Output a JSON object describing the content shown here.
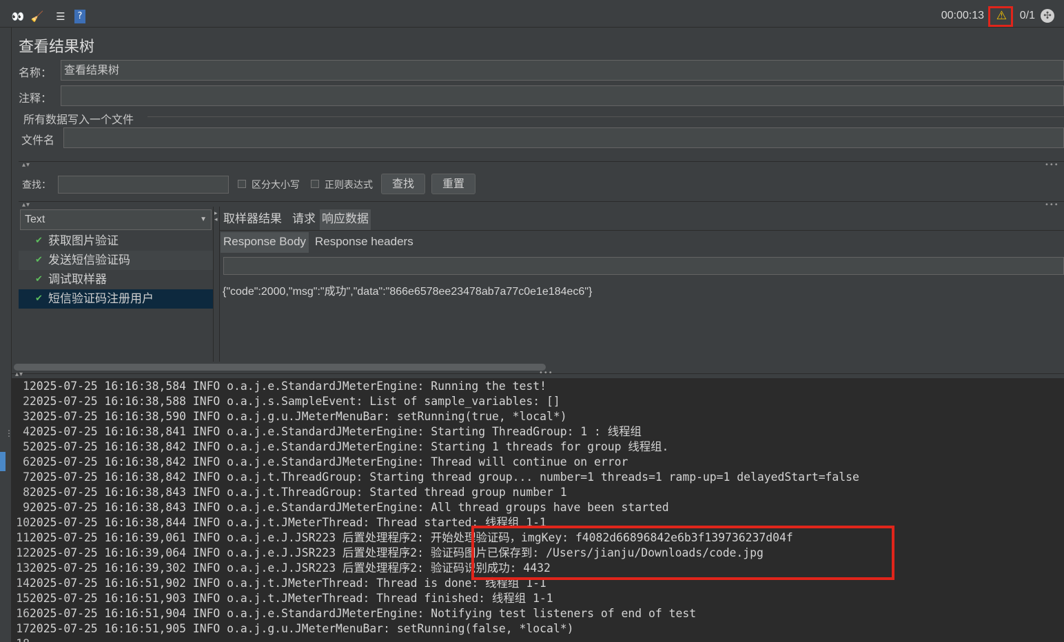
{
  "toolbar": {
    "timer": "00:00:13",
    "threads": "0/1",
    "icons": [
      "binoculars-icon",
      "broom-icon",
      "list-icon",
      "help-icon",
      "warning-icon",
      "globe-icon"
    ]
  },
  "panel": {
    "title": "查看结果树",
    "name_label": "名称：",
    "name_value": "查看结果树",
    "comment_label": "注释：",
    "comment_value": "",
    "file_section_label": "所有数据写入一个文件",
    "filename_label": "文件名",
    "filename_value": ""
  },
  "search": {
    "label": "查找：",
    "value": "",
    "case_label": "区分大小写",
    "regex_label": "正则表达式",
    "find_button": "查找",
    "reset_button": "重置"
  },
  "tree": {
    "renderer": "Text",
    "items": [
      {
        "label": "获取图片验证"
      },
      {
        "label": "发送短信验证码"
      },
      {
        "label": "调试取样器"
      },
      {
        "label": "短信验证码注册用户"
      }
    ]
  },
  "result": {
    "tabs": [
      "取样器结果",
      "请求",
      "响应数据"
    ],
    "subtabs": [
      "Response Body",
      "Response headers"
    ],
    "body": "{\"code\":2000,\"msg\":\"成功\",\"data\":\"866e6578ee23478ab7a77c0e1e184ec6\"}"
  },
  "log": {
    "lines": [
      {
        "n": "1",
        "text": "2025-07-25 16:16:38,584 INFO o.a.j.e.StandardJMeterEngine: Running the test!"
      },
      {
        "n": "2",
        "text": "2025-07-25 16:16:38,588 INFO o.a.j.s.SampleEvent: List of sample_variables: []"
      },
      {
        "n": "3",
        "text": "2025-07-25 16:16:38,590 INFO o.a.j.g.u.JMeterMenuBar: setRunning(true, *local*)"
      },
      {
        "n": "4",
        "text": "2025-07-25 16:16:38,841 INFO o.a.j.e.StandardJMeterEngine: Starting ThreadGroup: 1 : 线程组"
      },
      {
        "n": "5",
        "text": "2025-07-25 16:16:38,842 INFO o.a.j.e.StandardJMeterEngine: Starting 1 threads for group 线程组."
      },
      {
        "n": "6",
        "text": "2025-07-25 16:16:38,842 INFO o.a.j.e.StandardJMeterEngine: Thread will continue on error"
      },
      {
        "n": "7",
        "text": "2025-07-25 16:16:38,842 INFO o.a.j.t.ThreadGroup: Starting thread group... number=1 threads=1 ramp-up=1 delayedStart=false"
      },
      {
        "n": "8",
        "text": "2025-07-25 16:16:38,843 INFO o.a.j.t.ThreadGroup: Started thread group number 1"
      },
      {
        "n": "9",
        "text": "2025-07-25 16:16:38,843 INFO o.a.j.e.StandardJMeterEngine: All thread groups have been started"
      },
      {
        "n": "10",
        "text": "2025-07-25 16:16:38,844 INFO o.a.j.t.JMeterThread: Thread started: 线程组 1-1"
      },
      {
        "n": "11",
        "text": "2025-07-25 16:16:39,061 INFO o.a.j.e.J.JSR223 后置处理程序2: 开始处理验证码，imgKey: f4082d66896842e6b3f139736237d04f"
      },
      {
        "n": "12",
        "text": "2025-07-25 16:16:39,064 INFO o.a.j.e.J.JSR223 后置处理程序2: 验证码图片已保存到: /Users/jianju/Downloads/code.jpg"
      },
      {
        "n": "13",
        "text": "2025-07-25 16:16:39,302 INFO o.a.j.e.J.JSR223 后置处理程序2: 验证码识别成功: 4432"
      },
      {
        "n": "14",
        "text": "2025-07-25 16:16:51,902 INFO o.a.j.t.JMeterThread: Thread is done: 线程组 1-1"
      },
      {
        "n": "15",
        "text": "2025-07-25 16:16:51,903 INFO o.a.j.t.JMeterThread: Thread finished: 线程组 1-1"
      },
      {
        "n": "16",
        "text": "2025-07-25 16:16:51,904 INFO o.a.j.e.StandardJMeterEngine: Notifying test listeners of end of test"
      },
      {
        "n": "17",
        "text": "2025-07-25 16:16:51,905 INFO o.a.j.g.u.JMeterMenuBar: setRunning(false, *local*)"
      },
      {
        "n": "18",
        "text": ""
      }
    ]
  },
  "colors": {
    "background": "#3c3f41",
    "log_background": "#2b2b2b",
    "selection": "#0d293e",
    "highlight": "#e0251b",
    "success": "#5ec05e"
  }
}
